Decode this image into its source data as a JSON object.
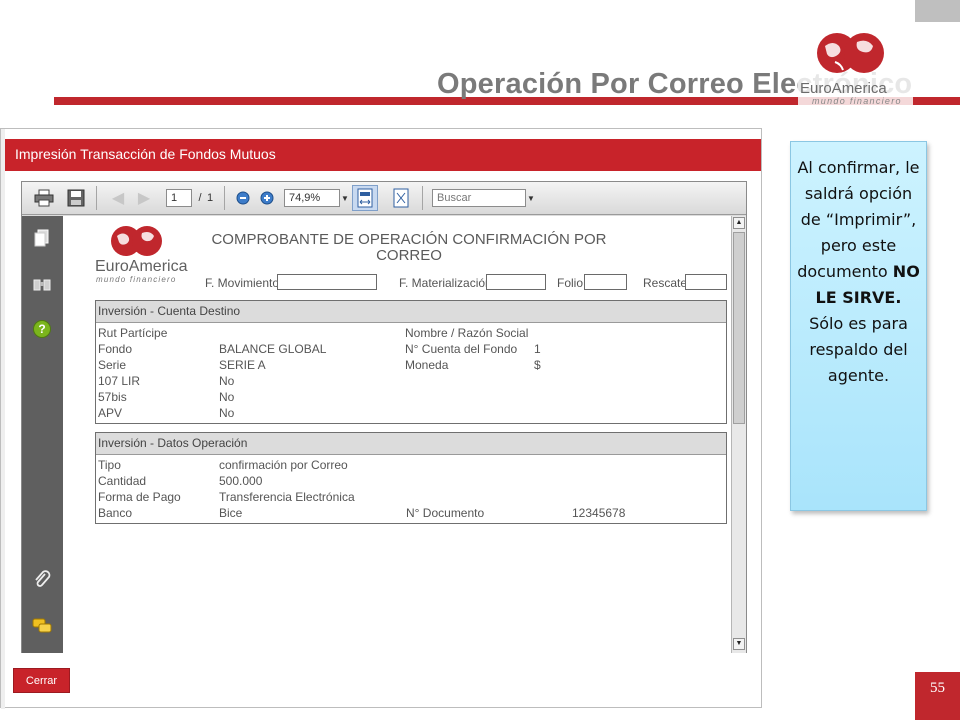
{
  "slide": {
    "title": "Operación Por Correo Electrónico",
    "page_number": "55",
    "logo": {
      "brand": "EuroAmerica",
      "tagline": "mundo financiero"
    }
  },
  "app": {
    "header_title": "Impresión Transacción de Fondos Mutuos",
    "close_button": "Cerrar",
    "toolbar": {
      "page_current": "1",
      "page_sep": "/",
      "page_total": "1",
      "zoom": "74,9%",
      "search_placeholder": "Buscar"
    },
    "document": {
      "logo": {
        "brand": "EuroAmerica",
        "tagline": "mundo financiero"
      },
      "title": "COMPROBANTE DE OPERACIÓN CONFIRMACIÓN POR CORREO",
      "fields": {
        "movimiento": "F. Movimiento:",
        "materializacion": "F. Materialización:",
        "folio": "Folio:",
        "rescate": "Rescate:"
      },
      "section1": {
        "title": "Inversión - Cuenta Destino",
        "rows": [
          {
            "label": "Rut Partícipe",
            "value": "",
            "label2": "Nombre / Razón Social",
            "value2": ""
          },
          {
            "label": "Fondo",
            "value": "BALANCE GLOBAL",
            "label2": "N° Cuenta del Fondo",
            "value2": "1"
          },
          {
            "label": "Serie",
            "value": "SERIE A",
            "label2": "Moneda",
            "value2": "$"
          },
          {
            "label": "107 LIR",
            "value": "No",
            "label2": "",
            "value2": ""
          },
          {
            "label": "57bis",
            "value": "No",
            "label2": "",
            "value2": ""
          },
          {
            "label": "APV",
            "value": "No",
            "label2": "",
            "value2": ""
          }
        ]
      },
      "section2": {
        "title": "Inversión - Datos Operación",
        "rows": [
          {
            "label": "Tipo",
            "value": "confirmación por Correo",
            "label2": "",
            "value2": ""
          },
          {
            "label": "Cantidad",
            "value": "500.000",
            "label2": "",
            "value2": ""
          },
          {
            "label": "Forma de Pago",
            "value": "Transferencia Electrónica",
            "label2": "",
            "value2": ""
          },
          {
            "label": "Banco",
            "value": "Bice",
            "label2": "N° Documento",
            "value2": "12345678"
          }
        ]
      }
    }
  },
  "callout": {
    "text_before": "Al confirmar, le saldrá opción de “Imprimir”, pero este documento",
    "text_bold": "NO LE SIRVE.",
    "text_after": "Sólo es para respaldo del agente."
  },
  "colors": {
    "brand_red": "#c8232a",
    "callout_bg": "#b8eafd",
    "title_gray": "#7a7a7a"
  }
}
